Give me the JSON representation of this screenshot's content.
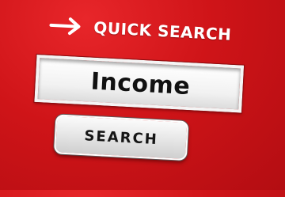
{
  "quick_search": {
    "heading": "QUICK SEARCH",
    "arrow_icon": "arrow-right-icon"
  },
  "search": {
    "value": "Income"
  },
  "search_button": {
    "label": "SEARCH"
  },
  "colors": {
    "background": "#d1171b",
    "text_light": "#ffffff",
    "field_bg": "#f4f4f4",
    "button_bg": "#e6e6e6",
    "text_dark": "#111111"
  }
}
